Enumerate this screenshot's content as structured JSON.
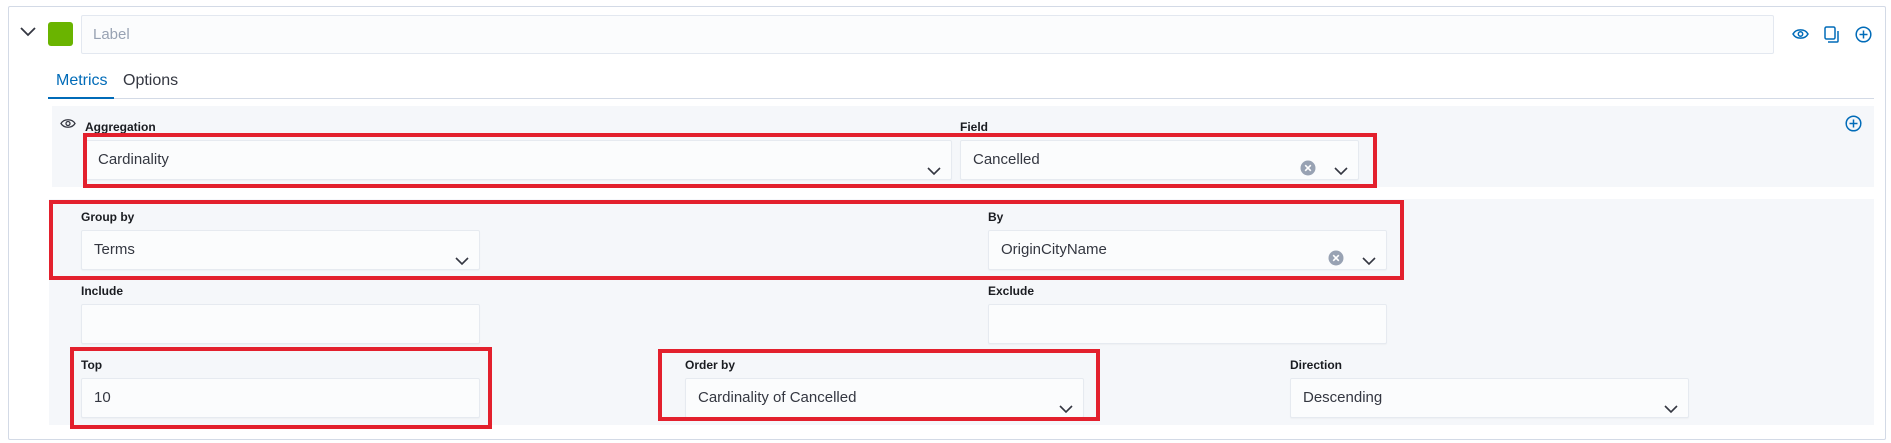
{
  "colors": {
    "accent": "#006bb8",
    "swatch": "#6ab400",
    "highlight": "#e3202d",
    "row_bg": "#f5f7fa"
  },
  "header": {
    "label_placeholder": "Label",
    "icons": [
      "chevron-down-icon",
      "eye-icon",
      "copy-icon",
      "plus-circle-icon"
    ]
  },
  "tabs": [
    {
      "label": "Metrics",
      "active": true
    },
    {
      "label": "Options",
      "active": false
    }
  ],
  "metric": {
    "aggregation_label": "Aggregation",
    "aggregation_value": "Cardinality",
    "field_label": "Field",
    "field_value": "Cancelled"
  },
  "group": {
    "group_by_label": "Group by",
    "group_by_value": "Terms",
    "by_label": "By",
    "by_value": "OriginCityName",
    "include_label": "Include",
    "include_value": "",
    "exclude_label": "Exclude",
    "exclude_value": "",
    "top_label": "Top",
    "top_value": "10",
    "order_by_label": "Order by",
    "order_by_value": "Cardinality of Cancelled",
    "direction_label": "Direction",
    "direction_value": "Descending"
  }
}
